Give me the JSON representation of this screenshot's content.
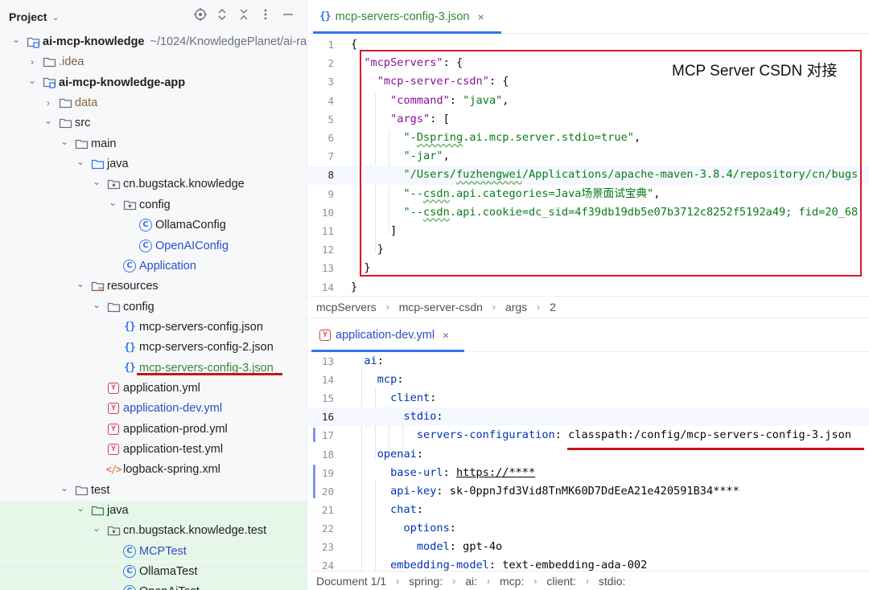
{
  "project_panel": {
    "title": "Project",
    "tree": [
      {
        "label": "ai-mcp-knowledge",
        "hint": "~/1024/KnowledgePlanet/ai-ra",
        "depth": 0,
        "arrow": "open",
        "icon": "module-folder-icon",
        "style": "bold"
      },
      {
        "label": ".idea",
        "depth": 1,
        "arrow": "closed",
        "icon": "folder-icon",
        "style": "brown"
      },
      {
        "label": "ai-mcp-knowledge-app",
        "depth": 1,
        "arrow": "open",
        "icon": "module-folder-icon",
        "style": "bold"
      },
      {
        "label": "data",
        "depth": 2,
        "arrow": "closed",
        "icon": "folder-icon",
        "style": "brown"
      },
      {
        "label": "src",
        "depth": 2,
        "arrow": "open",
        "icon": "folder-icon",
        "style": "normal"
      },
      {
        "label": "main",
        "depth": 3,
        "arrow": "open",
        "icon": "folder-icon",
        "style": "normal"
      },
      {
        "label": "java",
        "depth": 4,
        "arrow": "open",
        "icon": "source-folder-icon",
        "style": "normal"
      },
      {
        "label": "cn.bugstack.knowledge",
        "depth": 5,
        "arrow": "open",
        "icon": "package-icon",
        "style": "normal"
      },
      {
        "label": "config",
        "depth": 6,
        "arrow": "open",
        "icon": "package-icon",
        "style": "normal"
      },
      {
        "label": "OllamaConfig",
        "depth": 7,
        "arrow": "none",
        "icon": "class-icon",
        "style": "normal"
      },
      {
        "label": "OpenAIConfig",
        "depth": 7,
        "arrow": "none",
        "icon": "class-icon",
        "style": "blue"
      },
      {
        "label": "Application",
        "depth": 6,
        "arrow": "none",
        "icon": "class-icon",
        "style": "blue"
      },
      {
        "label": "resources",
        "depth": 4,
        "arrow": "open",
        "icon": "resources-folder-icon",
        "style": "normal"
      },
      {
        "label": "config",
        "depth": 5,
        "arrow": "open",
        "icon": "folder-icon",
        "style": "normal"
      },
      {
        "label": "mcp-servers-config.json",
        "depth": 6,
        "arrow": "none",
        "icon": "json-file-icon",
        "style": "normal"
      },
      {
        "label": "mcp-servers-config-2.json",
        "depth": 6,
        "arrow": "none",
        "icon": "json-file-icon",
        "style": "normal"
      },
      {
        "label": "mcp-servers-config-3.json",
        "depth": 6,
        "arrow": "none",
        "icon": "json-file-icon",
        "style": "green"
      },
      {
        "label": "application.yml",
        "depth": 5,
        "arrow": "none",
        "icon": "yaml-file-icon",
        "style": "normal"
      },
      {
        "label": "application-dev.yml",
        "depth": 5,
        "arrow": "none",
        "icon": "yaml-file-icon",
        "style": "blue"
      },
      {
        "label": "application-prod.yml",
        "depth": 5,
        "arrow": "none",
        "icon": "yaml-file-icon",
        "style": "normal"
      },
      {
        "label": "application-test.yml",
        "depth": 5,
        "arrow": "none",
        "icon": "yaml-file-icon",
        "style": "normal"
      },
      {
        "label": "logback-spring.xml",
        "depth": 5,
        "arrow": "none",
        "icon": "xml-file-icon",
        "style": "normal"
      },
      {
        "label": "test",
        "depth": 3,
        "arrow": "open",
        "icon": "folder-icon",
        "style": "normal"
      },
      {
        "label": "java",
        "depth": 4,
        "arrow": "open",
        "icon": "test-folder-icon",
        "style": "normal",
        "bg": "green"
      },
      {
        "label": "cn.bugstack.knowledge.test",
        "depth": 5,
        "arrow": "open",
        "icon": "package-icon",
        "style": "normal",
        "bg": "green"
      },
      {
        "label": "MCPTest",
        "depth": 6,
        "arrow": "none",
        "icon": "class-icon",
        "style": "blue",
        "bg": "green"
      },
      {
        "label": "OllamaTest",
        "depth": 6,
        "arrow": "none",
        "icon": "class-icon",
        "style": "normal",
        "bg": "green"
      },
      {
        "label": "OpenAiTest",
        "depth": 6,
        "arrow": "none",
        "icon": "class-icon",
        "style": "normal",
        "bg": "green"
      }
    ]
  },
  "editor_top": {
    "tab_label": "mcp-servers-config-3.json",
    "annotation": "MCP Server CSDN 对接",
    "lines": [
      {
        "n": "1",
        "parts": [
          [
            "p",
            "{"
          ]
        ]
      },
      {
        "n": "2",
        "parts": [
          [
            "p",
            "  "
          ],
          [
            "k",
            "\"mcpServers\""
          ],
          [
            "p",
            ": {"
          ]
        ]
      },
      {
        "n": "3",
        "parts": [
          [
            "p",
            "    "
          ],
          [
            "k",
            "\"mcp-server-csdn\""
          ],
          [
            "p",
            ": {"
          ]
        ]
      },
      {
        "n": "4",
        "parts": [
          [
            "p",
            "      "
          ],
          [
            "k",
            "\"command\""
          ],
          [
            "p",
            ": "
          ],
          [
            "s",
            "\"java\""
          ],
          [
            "p",
            ","
          ]
        ]
      },
      {
        "n": "5",
        "parts": [
          [
            "p",
            "      "
          ],
          [
            "k",
            "\"args\""
          ],
          [
            "p",
            ": ["
          ]
        ]
      },
      {
        "n": "6",
        "parts": [
          [
            "p",
            "        "
          ],
          [
            "s",
            "\"-"
          ],
          [
            "sw",
            "Dspring"
          ],
          [
            "s",
            ".ai.mcp.server.stdio=true\""
          ],
          [
            "p",
            ","
          ]
        ]
      },
      {
        "n": "7",
        "parts": [
          [
            "p",
            "        "
          ],
          [
            "s",
            "\"-jar\""
          ],
          [
            "p",
            ","
          ]
        ]
      },
      {
        "n": "8",
        "parts": [
          [
            "p",
            "        "
          ],
          [
            "s",
            "\"/Users/"
          ],
          [
            "sw",
            "fuzhengwei"
          ],
          [
            "s",
            "/Applications/apache-maven-3.8.4/repository/cn/bugs"
          ]
        ],
        "current": true
      },
      {
        "n": "9",
        "parts": [
          [
            "p",
            "        "
          ],
          [
            "s",
            "\"--"
          ],
          [
            "sw",
            "csdn"
          ],
          [
            "s",
            ".api.categories=Java场景面试宝典\""
          ],
          [
            "p",
            ","
          ]
        ]
      },
      {
        "n": "10",
        "parts": [
          [
            "p",
            "        "
          ],
          [
            "s",
            "\"--"
          ],
          [
            "sw",
            "csdn"
          ],
          [
            "s",
            ".api.cookie=dc_sid=4f39db19db5e07b3712c8252f5192a49; fid=20_68"
          ]
        ]
      },
      {
        "n": "11",
        "parts": [
          [
            "p",
            "      ]"
          ]
        ]
      },
      {
        "n": "12",
        "parts": [
          [
            "p",
            "    }"
          ]
        ]
      },
      {
        "n": "13",
        "parts": [
          [
            "p",
            "  }"
          ]
        ]
      },
      {
        "n": "14",
        "parts": [
          [
            "p",
            "}"
          ]
        ]
      }
    ],
    "breadcrumb": [
      "mcpServers",
      "mcp-server-csdn",
      "args",
      "2"
    ]
  },
  "editor_bottom": {
    "tab_label": "application-dev.yml",
    "lines": [
      {
        "n": "13",
        "parts": [
          [
            "p",
            "  "
          ],
          [
            "y",
            "ai"
          ],
          [
            "p",
            ":"
          ]
        ]
      },
      {
        "n": "14",
        "parts": [
          [
            "p",
            "    "
          ],
          [
            "y",
            "mcp"
          ],
          [
            "p",
            ":"
          ]
        ]
      },
      {
        "n": "15",
        "parts": [
          [
            "p",
            "      "
          ],
          [
            "y",
            "client"
          ],
          [
            "p",
            ":"
          ]
        ]
      },
      {
        "n": "16",
        "parts": [
          [
            "p",
            "        "
          ],
          [
            "y",
            "stdio"
          ],
          [
            "p",
            ":"
          ]
        ],
        "current": true
      },
      {
        "n": "17",
        "parts": [
          [
            "p",
            "          "
          ],
          [
            "y",
            "servers-configuration"
          ],
          [
            "p",
            ": classpath:/config/mcp-servers-config-3.json"
          ]
        ]
      },
      {
        "n": "18",
        "parts": [
          [
            "p",
            "    "
          ],
          [
            "y",
            "openai"
          ],
          [
            "p",
            ":"
          ]
        ]
      },
      {
        "n": "19",
        "parts": [
          [
            "p",
            "      "
          ],
          [
            "y",
            "base-url"
          ],
          [
            "p",
            ": "
          ],
          [
            "u",
            "https://****"
          ]
        ]
      },
      {
        "n": "20",
        "parts": [
          [
            "p",
            "      "
          ],
          [
            "y",
            "api-key"
          ],
          [
            "p",
            ": sk-0ppnJfd3Vid8TnMK60D7DdEeA21e420591B34****"
          ]
        ]
      },
      {
        "n": "21",
        "parts": [
          [
            "p",
            "      "
          ],
          [
            "y",
            "chat"
          ],
          [
            "p",
            ":"
          ]
        ]
      },
      {
        "n": "22",
        "parts": [
          [
            "p",
            "        "
          ],
          [
            "y",
            "options"
          ],
          [
            "p",
            ":"
          ]
        ]
      },
      {
        "n": "23",
        "parts": [
          [
            "p",
            "          "
          ],
          [
            "y",
            "model"
          ],
          [
            "p",
            ": gpt-4o"
          ]
        ]
      },
      {
        "n": "24",
        "parts": [
          [
            "p",
            "      "
          ],
          [
            "y",
            "embedding-model"
          ],
          [
            "p",
            ": text-embedding-ada-002"
          ]
        ]
      }
    ],
    "breadcrumb": [
      "Document 1/1",
      "spring:",
      "ai:",
      "mcp:",
      "client:",
      "stdio:"
    ]
  },
  "colors": {
    "accent": "#3574f0",
    "annotation_red": "#d51b2b",
    "json_key": "#871094",
    "string": "#067d17",
    "yaml_key": "#0033b3",
    "test_bg": "#e6f7e9"
  }
}
